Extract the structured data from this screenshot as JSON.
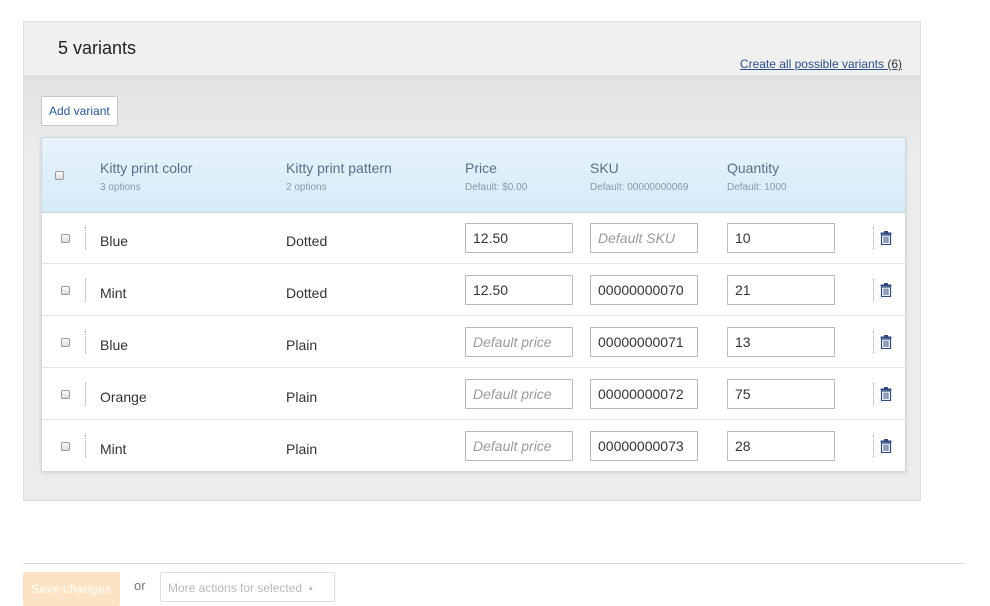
{
  "panel": {
    "title": "5 variants",
    "create_link_label": "Create all possible variants",
    "create_link_count": "(6)",
    "add_variant_label": "Add variant"
  },
  "table": {
    "columns": [
      {
        "title": "Kitty print color",
        "sub": "3 options"
      },
      {
        "title": "Kitty print pattern",
        "sub": "2 options"
      },
      {
        "title": "Price",
        "sub": "Default: $0.00"
      },
      {
        "title": "SKU",
        "sub": "Default: 00000000069"
      },
      {
        "title": "Quantity",
        "sub": "Default: 1000"
      }
    ],
    "placeholders": {
      "price": "Default price",
      "sku": "Default SKU"
    },
    "rows": [
      {
        "color": "Blue",
        "pattern": "Dotted",
        "price": "12.50",
        "sku": "",
        "quantity": "10"
      },
      {
        "color": "Mint",
        "pattern": "Dotted",
        "price": "12.50",
        "sku": "00000000070",
        "quantity": "21"
      },
      {
        "color": "Blue",
        "pattern": "Plain",
        "price": "",
        "sku": "00000000071",
        "quantity": "13"
      },
      {
        "color": "Orange",
        "pattern": "Plain",
        "price": "",
        "sku": "00000000072",
        "quantity": "75"
      },
      {
        "color": "Mint",
        "pattern": "Plain",
        "price": "",
        "sku": "00000000073",
        "quantity": "28"
      }
    ]
  },
  "footer": {
    "save_label": "Save changes",
    "or_label": "or",
    "more_actions_label": "More actions for selected"
  },
  "icons": {
    "row_delete": "trash-icon",
    "dropdown": "caret-up-icon"
  },
  "colors": {
    "link": "#2a4f86",
    "header_bg": "#d6ebf8",
    "save_button": "#fbe3c3"
  }
}
